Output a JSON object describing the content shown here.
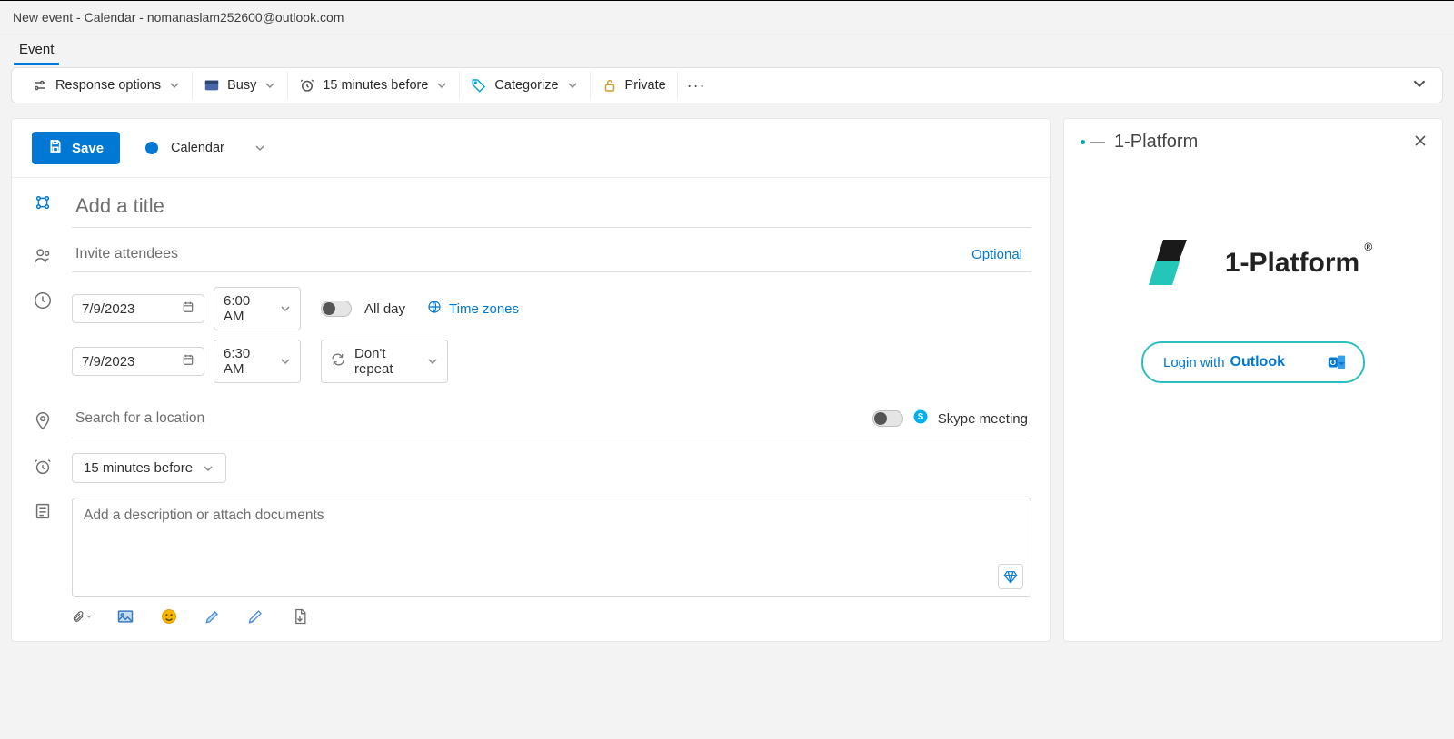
{
  "window": {
    "title": "New event - Calendar - nomanaslam252600@outlook.com"
  },
  "tabs": {
    "event": "Event"
  },
  "ribbon": {
    "response_options": "Response options",
    "busy": "Busy",
    "reminder": "15 minutes before",
    "categorize": "Categorize",
    "private": "Private",
    "more": "···"
  },
  "save_row": {
    "save": "Save",
    "calendar": "Calendar"
  },
  "form": {
    "title_placeholder": "Add a title",
    "attendees_placeholder": "Invite attendees",
    "optional": "Optional",
    "start_date": "7/9/2023",
    "start_time": "6:00 AM",
    "end_date": "7/9/2023",
    "end_time": "6:30 AM",
    "all_day": "All day",
    "time_zones": "Time zones",
    "repeat": "Don't repeat",
    "location_placeholder": "Search for a location",
    "skype": "Skype meeting",
    "reminder": "15 minutes before",
    "description_placeholder": "Add a description or attach documents"
  },
  "panel": {
    "title": "1-Platform",
    "logo_text": "1-Platform",
    "reg": "®",
    "login_prefix": "Login with ",
    "login_brand": "Outlook"
  },
  "colors": {
    "accent": "#0078d4",
    "teal": "#2fbebe"
  }
}
